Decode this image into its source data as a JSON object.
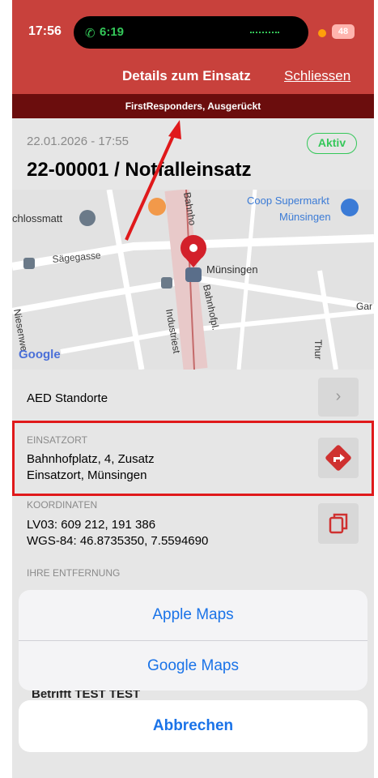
{
  "status_bar": {
    "time": "17:56",
    "call_time": "6:19",
    "battery": "48"
  },
  "header": {
    "title": "Details zum Einsatz",
    "close_label": "Schliessen"
  },
  "banner": {
    "text": "FirstResponders, Ausgerückt"
  },
  "einsatz": {
    "date": "22.01.2026 - 17:55",
    "status": "Aktiv",
    "title": "22-00001 / Notfalleinsatz"
  },
  "map": {
    "labels": {
      "schlossmatt": "chlossmatt",
      "saegegasse": "Sägegasse",
      "bahnhofstrasse": "Bahnho",
      "coop": "Coop Supermarkt",
      "coop_city": "Münsingen",
      "station": "Münsingen",
      "bahnhofpl": "Bahnhofpl.",
      "industriestr": "Industriest",
      "niesenweg": "Niesenwe",
      "gar": "Gar",
      "thur": "Thur",
      "google": "Google"
    },
    "pin_color": "#d3202a"
  },
  "aed": {
    "label": "AED Standorte"
  },
  "einsatzort": {
    "label": "EINSATZORT",
    "line1": "Bahnhofplatz, 4, Zusatz",
    "line2": "Einsatzort, Münsingen"
  },
  "koordinaten": {
    "label": "KOORDINATEN",
    "lv03": "LV03: 609 212, 191 386",
    "wgs84": "WGS-84: 46.8735350, 7.5594690"
  },
  "entfernung": {
    "label": "IHRE ENTFERNUNG"
  },
  "hidden_text": "Betrifft TEST TEST",
  "action_sheet": {
    "apple_maps": "Apple Maps",
    "google_maps": "Google Maps",
    "cancel": "Abbrechen"
  },
  "colors": {
    "header": "#c8413c",
    "banner": "#6b0d0d",
    "accent_green": "#34c759",
    "link_blue": "#1a73e8",
    "annotation_red": "#e0191b"
  }
}
